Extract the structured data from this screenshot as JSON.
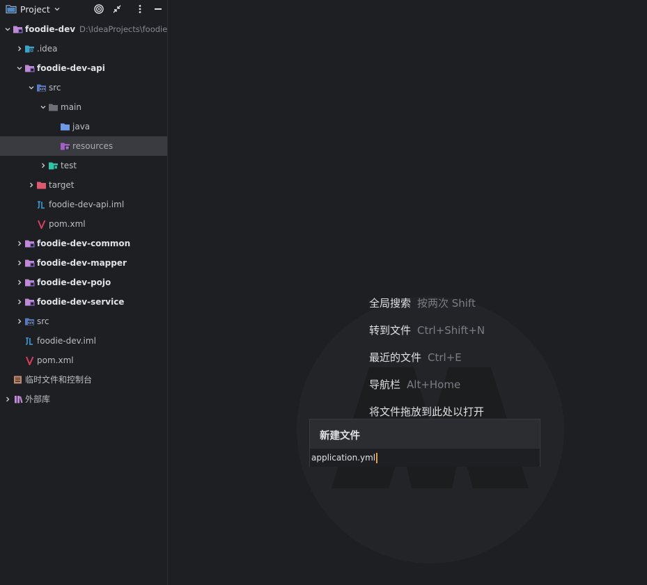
{
  "panel": {
    "title": "Project",
    "buttons": [
      "locate-icon",
      "collapse-icon",
      "more-icon",
      "minimize-icon"
    ]
  },
  "tree": [
    {
      "label": "foodie-dev",
      "hint": "D:\\IdeaProjects\\foodie-de",
      "icon": "module-folder-icon",
      "bold": true,
      "expanded": true
    },
    {
      "label": ".idea",
      "icon": "idea-folder-icon",
      "expanded": false
    },
    {
      "label": "foodie-dev-api",
      "icon": "module-folder-icon",
      "bold": true,
      "expanded": true
    },
    {
      "label": "src",
      "icon": "source-folder-icon",
      "expanded": true
    },
    {
      "label": "main",
      "icon": "folder-icon",
      "expanded": true
    },
    {
      "label": "java",
      "icon": "java-folder-icon"
    },
    {
      "label": "resources",
      "icon": "resources-folder-icon",
      "selected": true
    },
    {
      "label": "test",
      "icon": "test-folder-icon",
      "expanded": false
    },
    {
      "label": "target",
      "icon": "excluded-folder-icon",
      "expanded": false
    },
    {
      "label": "foodie-dev-api.iml",
      "icon": "iml-file-icon"
    },
    {
      "label": "pom.xml",
      "icon": "maven-file-icon"
    },
    {
      "label": "foodie-dev-common",
      "icon": "module-folder-icon",
      "bold": true,
      "expanded": false
    },
    {
      "label": "foodie-dev-mapper",
      "icon": "module-folder-icon",
      "bold": true,
      "expanded": false
    },
    {
      "label": "foodie-dev-pojo",
      "icon": "module-folder-icon",
      "bold": true,
      "expanded": false
    },
    {
      "label": "foodie-dev-service",
      "icon": "module-folder-icon",
      "bold": true,
      "expanded": false
    },
    {
      "label": "src",
      "icon": "source-folder-icon",
      "expanded": false
    },
    {
      "label": "foodie-dev.iml",
      "icon": "iml-file-icon"
    },
    {
      "label": "pom.xml",
      "icon": "maven-file-icon"
    },
    {
      "label": "临时文件和控制台",
      "icon": "scratches-icon"
    },
    {
      "label": "外部库",
      "icon": "library-icon",
      "expanded": false
    }
  ],
  "editor": {
    "hints": [
      {
        "label": "全局搜索",
        "shortcut": "按两次 Shift"
      },
      {
        "label": "转到文件",
        "shortcut": "Ctrl+Shift+N"
      },
      {
        "label": "最近的文件",
        "shortcut": "Ctrl+E"
      },
      {
        "label": "导航栏",
        "shortcut": "Alt+Home"
      },
      {
        "label": "将文件拖放到此处以打开",
        "shortcut": ""
      }
    ]
  },
  "new_file_popup": {
    "title": "新建文件",
    "value": "application.yml"
  },
  "colors": {
    "background": "#1e1f22",
    "selection": "#393b40",
    "caret": "#e6a23c"
  }
}
